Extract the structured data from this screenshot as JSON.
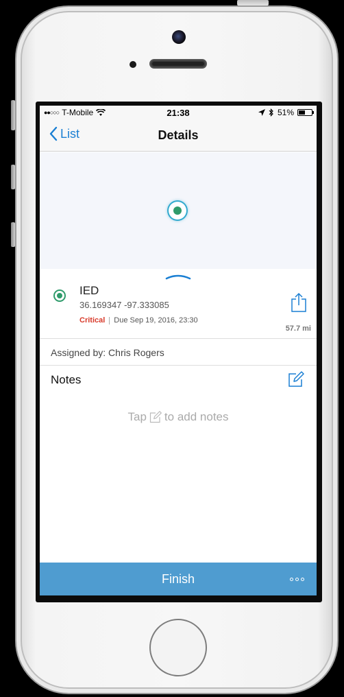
{
  "status_bar": {
    "signal": "●●○○○",
    "carrier": "T-Mobile",
    "time": "21:38",
    "battery": "51%",
    "battery_level": 0.51
  },
  "nav": {
    "back_label": "List",
    "title": "Details"
  },
  "item": {
    "title": "IED",
    "coordinates": "36.169347  -97.333085",
    "priority": "Critical",
    "due": "Due Sep 19, 2016, 23:30",
    "distance": "57.7 mi"
  },
  "assigned": {
    "text": "Assigned by: Chris Rogers"
  },
  "notes": {
    "title": "Notes",
    "hint_prefix": "Tap",
    "hint_suffix": "to add notes"
  },
  "footer": {
    "finish_label": "Finish"
  },
  "colors": {
    "accent": "#1a7fd3",
    "bar": "#4f9cd0",
    "status_green": "#2f9b6b",
    "critical": "#d83a2a"
  }
}
